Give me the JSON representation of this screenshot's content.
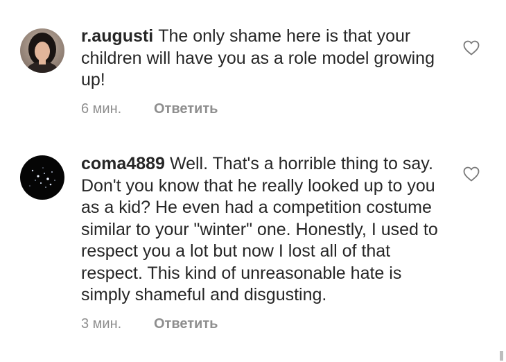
{
  "comments": [
    {
      "username": "r.augusti",
      "text": "The only shame here is that your children will have you as a role model growing up!",
      "time": "6 мин.",
      "reply_label": "Ответить",
      "like_icon": "heart-outline-icon",
      "avatar": "user-avatar"
    },
    {
      "username": "coma4889",
      "text": "Well. That's a horrible thing to say. Don't you know that he really looked up to you as a kid? He even had a competition costume similar to your \"winter\" one. Honestly, I used to respect you a lot but now I lost all of that respect. This kind of unreasonable hate is simply shameful and disgusting.",
      "time": "3 мин.",
      "reply_label": "Ответить",
      "like_icon": "heart-outline-icon",
      "avatar": "user-avatar"
    }
  ],
  "colors": {
    "text": "#262626",
    "secondary": "#8e8e8e",
    "background": "#ffffff"
  }
}
